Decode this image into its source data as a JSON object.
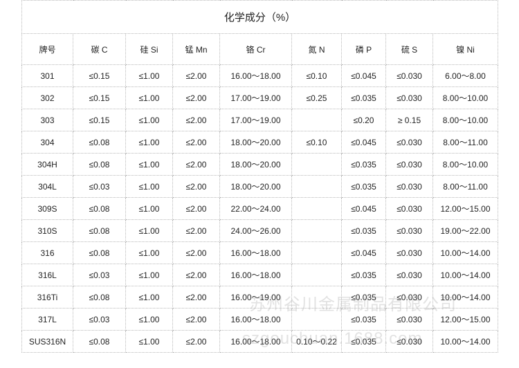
{
  "title": "化学成分（%）",
  "headers": [
    "牌号",
    "碳 C",
    "硅 Si",
    "锰 Mn",
    "铬 Cr",
    "氮 N",
    "磷 P",
    "硫 S",
    "镍 Ni"
  ],
  "rows": [
    [
      "301",
      "≤0.15",
      "≤1.00",
      "≤2.00",
      "16.00～18.00",
      "≤0.10",
      "≤0.045",
      "≤0.030",
      "6.00～8.00"
    ],
    [
      "302",
      "≤0.15",
      "≤1.00",
      "≤2.00",
      "17.00～19.00",
      "≤0.25",
      "≤0.035",
      "≤0.030",
      "8.00～10.00"
    ],
    [
      "303",
      "≤0.15",
      "≤1.00",
      "≤2.00",
      "17.00～19.00",
      "",
      "≤0.20",
      "≥ 0.15",
      "8.00～10.00"
    ],
    [
      "304",
      "≤0.08",
      "≤1.00",
      "≤2.00",
      "18.00～20.00",
      "≤0.10",
      "≤0.045",
      "≤0.030",
      "8.00～11.00"
    ],
    [
      "304H",
      "≤0.08",
      "≤1.00",
      "≤2.00",
      "18.00～20.00",
      "",
      "≤0.035",
      "≤0.030",
      "8.00～10.00"
    ],
    [
      "304L",
      "≤0.03",
      "≤1.00",
      "≤2.00",
      "18.00～20.00",
      "",
      "≤0.035",
      "≤0.030",
      "8.00～11.00"
    ],
    [
      "309S",
      "≤0.08",
      "≤1.00",
      "≤2.00",
      "22.00～24.00",
      "",
      "≤0.045",
      "≤0.030",
      "12.00～15.00"
    ],
    [
      "310S",
      "≤0.08",
      "≤1.00",
      "≤2.00",
      "24.00～26.00",
      "",
      "≤0.035",
      "≤0.030",
      "19.00～22.00"
    ],
    [
      "316",
      "≤0.08",
      "≤1.00",
      "≤2.00",
      "16.00～18.00",
      "",
      "≤0.045",
      "≤0.030",
      "10.00～14.00"
    ],
    [
      "316L",
      "≤0.03",
      "≤1.00",
      "≤2.00",
      "16.00～18.00",
      "",
      "≤0.035",
      "≤0.030",
      "10.00～14.00"
    ],
    [
      "316Ti",
      "≤0.08",
      "≤1.00",
      "≤2.00",
      "16.00～19.00",
      "",
      "≤0.035",
      "≤0.030",
      "10.00～14.00"
    ],
    [
      "317L",
      "≤0.03",
      "≤1.00",
      "≤2.00",
      "16.00～18.00",
      "",
      "≤0.035",
      "≤0.030",
      "12.00～15.00"
    ],
    [
      "SUS316N",
      "≤0.08",
      "≤1.00",
      "≤2.00",
      "16.00～18.00",
      "0.10～0.22",
      "≤0.035",
      "≤0.030",
      "10.00～14.00"
    ]
  ],
  "watermark": {
    "company": "苏州谷川金属制品有限公司",
    "site": "szgouchuan.1688.com"
  }
}
